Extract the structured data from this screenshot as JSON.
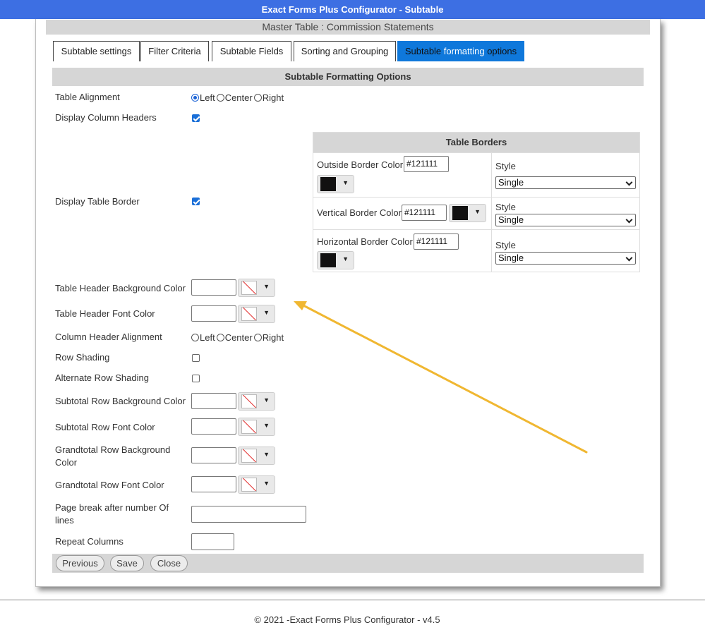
{
  "window": {
    "title": "Exact Forms Plus Configurator - Subtable"
  },
  "master_title": "Master Table : Commission Statements",
  "tabs": [
    {
      "label": "Subtable settings"
    },
    {
      "label": "Filter Criteria"
    },
    {
      "label": "Subtable Fields"
    },
    {
      "label": "Sorting and Grouping"
    },
    {
      "label_pre": "Subtable ",
      "label_hl": "formatting",
      "label_post": " options",
      "active": true
    }
  ],
  "section_title": "Subtable Formatting Options",
  "radio_options": {
    "left": "Left",
    "center": "Center",
    "right": "Right"
  },
  "fields": {
    "table_alignment": {
      "label": "Table Alignment",
      "selected": "Left"
    },
    "display_column_headers": {
      "label": "Display Column Headers",
      "checked": true
    },
    "display_table_border": {
      "label": "Display Table Border",
      "checked": true
    },
    "table_header_bg": {
      "label": "Table Header Background Color",
      "value": ""
    },
    "table_header_font": {
      "label": "Table Header Font Color",
      "value": ""
    },
    "column_header_alignment": {
      "label": "Column Header Alignment",
      "selected": ""
    },
    "row_shading": {
      "label": "Row Shading",
      "checked": false
    },
    "alternate_row_shading": {
      "label": "Alternate Row Shading",
      "checked": false
    },
    "subtotal_row_bg": {
      "label": "Subtotal Row Background Color",
      "value": ""
    },
    "subtotal_row_font": {
      "label": "Subtotal Row Font Color",
      "value": ""
    },
    "grandtotal_row_bg": {
      "label_line1": "Grandtotal Row Background",
      "label_line2": "Color",
      "value": ""
    },
    "grandtotal_row_font": {
      "label": "Grandtotal Row Font Color",
      "value": ""
    },
    "page_break": {
      "label_line1": "Page break after number Of",
      "label_line2": "lines",
      "value": ""
    },
    "repeat_columns": {
      "label": "Repeat Columns",
      "value": ""
    }
  },
  "table_borders": {
    "title": "Table Borders",
    "style_label": "Style",
    "outside": {
      "label": "Outside Border Color",
      "value": "#121111",
      "style": "Single"
    },
    "vertical": {
      "label": "Vertical Border Color",
      "value": "#121111",
      "style": "Single"
    },
    "horizontal": {
      "label": "Horizontal Border Color",
      "value": "#121111",
      "style": "Single"
    }
  },
  "buttons": {
    "previous": "Previous",
    "save": "Save",
    "close": "Close"
  },
  "footer": {
    "copyright": "© 2021 -Exact Forms Plus Configurator - v4.5"
  },
  "colors": {
    "title_bar": "#3d6fe3",
    "active_tab": "#0f78db",
    "annotation_arrow": "#f0b731",
    "border_color": "#121111"
  }
}
